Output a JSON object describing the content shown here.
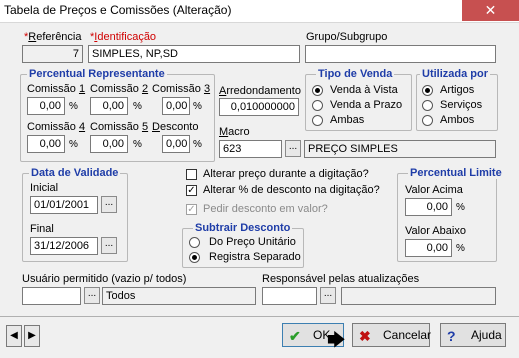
{
  "window": {
    "title": "Tabela de Preços e Comissões (Alteração)",
    "close_glyph": "✕"
  },
  "referencia": {
    "label": "*Referência",
    "value": "7"
  },
  "identificacao": {
    "label": "*Identificação",
    "value": "SIMPLES, NP,SD"
  },
  "grupo": {
    "label": "Grupo/Subgrupo",
    "value": ""
  },
  "percentual_representante": {
    "title": "Percentual Representante",
    "items": [
      {
        "label": "Comissão 1",
        "value": "0,00"
      },
      {
        "label": "Comissão 2",
        "value": "0,00"
      },
      {
        "label": "Comissão 3",
        "value": "0,00"
      },
      {
        "label": "Comissão 4",
        "value": "0,00"
      },
      {
        "label": "Comissão 5",
        "value": "0,00"
      },
      {
        "label": "Desconto",
        "value": "0,00"
      }
    ],
    "unit": "%"
  },
  "arredondamento": {
    "label": "Arredondamento",
    "value": "0,010000000"
  },
  "macro": {
    "label": "Macro",
    "code": "623",
    "name": "PREÇO SIMPLES"
  },
  "tipo_venda": {
    "title": "Tipo de Venda",
    "options": [
      "Venda à Vista",
      "Venda a Prazo",
      "Ambas"
    ],
    "selected": 0
  },
  "utilizada_por": {
    "title": "Utilizada por",
    "options": [
      "Artigos",
      "Serviços",
      "Ambos"
    ],
    "selected": 0
  },
  "data_validade": {
    "title": "Data de Validade",
    "inicial_label": "Inicial",
    "inicial": "01/01/2001",
    "final_label": "Final",
    "final": "31/12/2006"
  },
  "checkboxes": [
    {
      "label": "Alterar preço durante a digitação?",
      "checked": false,
      "enabled": true
    },
    {
      "label": "Alterar % de desconto na digitação?",
      "checked": true,
      "enabled": true
    },
    {
      "label": "Pedir desconto em valor?",
      "checked": true,
      "enabled": false
    }
  ],
  "subtrair_desconto": {
    "title": "Subtrair Desconto",
    "options": [
      "Do Preço Unitário",
      "Registra Separado"
    ],
    "selected": 1
  },
  "percentual_limite": {
    "title": "Percentual Limite",
    "acima_label": "Valor Acima",
    "acima": "0,00",
    "abaixo_label": "Valor Abaixo",
    "abaixo": "0,00",
    "unit": "%"
  },
  "usuario": {
    "label": "Usuário permitido (vazio p/ todos)",
    "code": "",
    "name": "Todos"
  },
  "responsavel": {
    "label": "Responsável pelas atualizações",
    "code": "",
    "name": ""
  },
  "buttons": {
    "ok": "OK",
    "cancelar": "Cancelar",
    "ajuda": "Ajuda"
  },
  "glyphs": {
    "ellipsis": "...",
    "prev": "◀",
    "next": "▶",
    "check": "✔",
    "x": "✖",
    "help": "?"
  },
  "colors": {
    "group_title": "#1f3da8",
    "required": "#d00000",
    "close": "#c75050"
  }
}
